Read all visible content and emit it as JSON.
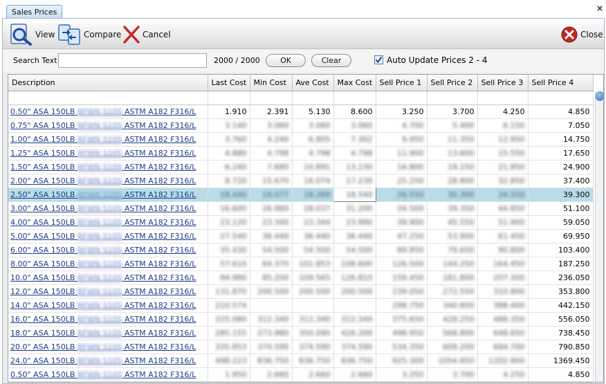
{
  "tab": {
    "label": "Sales Prices",
    "close": "×"
  },
  "toolbar": {
    "view": "View",
    "compare": "Compare",
    "cancel": "Cancel",
    "close": "Close"
  },
  "search": {
    "label": "Search Text",
    "value": "",
    "count": "2000 / 2000",
    "ok": "OK",
    "clear": "Clear",
    "auto_update_label": "Auto Update Prices 2 - 4",
    "auto_update_checked": true
  },
  "colors": {
    "accent": "#2d6cc1",
    "selected_row": "#b9dde8",
    "link": "#1c3a8c",
    "cancel_red": "#c62828"
  },
  "table": {
    "columns": [
      "Description",
      "Last Cost",
      "Min Cost",
      "Ave Cost",
      "Max Cost",
      "Sell Price 1",
      "Sell Price 2",
      "Sell Price 3",
      "Sell Price 4"
    ],
    "selected_index": 6,
    "rows": [
      {
        "size": "0.50\"",
        "spec": "ASTM A182 F316/L",
        "last": "1.910",
        "min": "2.391",
        "ave": "5.130",
        "max": "8.600",
        "p1": "3.250",
        "p2": "3.700",
        "p3": "4.250",
        "p4": "4.850",
        "clear": true
      },
      {
        "size": "0.75\"",
        "spec": "ASTM A182 F316/L",
        "last": "3.140",
        "min": "3.060",
        "ave": "3.060",
        "max": "3.060",
        "p1": "4.700",
        "p2": "5.400",
        "p3": "6.150",
        "p4": "7.050"
      },
      {
        "size": "1.00\"",
        "spec": "ASTM A182 F316/L",
        "last": "3.760",
        "min": "4.240",
        "ave": "6.805",
        "max": "7.302",
        "p1": "9.950",
        "p2": "11.350",
        "p3": "12.950",
        "p4": "14.750"
      },
      {
        "size": "1.25\"",
        "spec": "ASTM A182 F316/L",
        "last": "4.880",
        "min": "4.798",
        "ave": "4.798",
        "max": "4.798",
        "p1": "11.900",
        "p2": "13.600",
        "p3": "15.550",
        "p4": "17.650"
      },
      {
        "size": "1.50\"",
        "spec": "ASTM A182 F316/L",
        "last": "6.240",
        "min": "7.680",
        "ave": "10.891",
        "max": "13.230",
        "p1": "16.800",
        "p2": "19.150",
        "p3": "21.850",
        "p4": "24.900"
      },
      {
        "size": "2.00\"",
        "spec": "ASTM A182 F316/L",
        "last": "8.720",
        "min": "15.670",
        "ave": "16.074",
        "max": "17.230",
        "p1": "25.250",
        "p2": "28.800",
        "p3": "32.850",
        "p4": "37.400"
      },
      {
        "size": "2.50\"",
        "spec": "ASTM A182 F316/L",
        "last": "18.440",
        "min": "18.077",
        "ave": "18.269",
        "max": "18.540",
        "p1": "26.550",
        "p2": "30.300",
        "p3": "34.550",
        "p4": "39.300"
      },
      {
        "size": "3.00\"",
        "spec": "ASTM A182 F316/L",
        "last": "16.600",
        "min": "26.980",
        "ave": "28.037",
        "max": "31.200",
        "p1": "34.500",
        "p2": "39.350",
        "p3": "44.850",
        "p4": "51.100"
      },
      {
        "size": "4.00\"",
        "spec": "ASTM A182 F316/L",
        "last": "23.120",
        "min": "23.340",
        "ave": "23.344",
        "max": "23.990",
        "p1": "39.900",
        "p2": "45.550",
        "p3": "51.900",
        "p4": "59.050"
      },
      {
        "size": "5.00\"",
        "spec": "ASTM A182 F316/L",
        "last": "27.540",
        "min": "36.440",
        "ave": "36.440",
        "max": "36.440",
        "p1": "47.250",
        "p2": "53.900",
        "p3": "61.450",
        "p4": "69.950"
      },
      {
        "size": "6.00\"",
        "spec": "ASTM A182 F316/L",
        "last": "35.430",
        "min": "54.500",
        "ave": "54.500",
        "max": "54.500",
        "p1": "69.850",
        "p2": "79.650",
        "p3": "90.800",
        "p4": "103.400"
      },
      {
        "size": "8.00\"",
        "spec": "ASTM A182 F316/L",
        "last": "57.610",
        "min": "64.370",
        "ave": "101.853",
        "max": "108.600",
        "p1": "126.500",
        "p2": "144.250",
        "p3": "164.450",
        "p4": "187.250"
      },
      {
        "size": "10.0\"",
        "spec": "ASTM A182 F316/L",
        "last": "84.980",
        "min": "85.200",
        "ave": "109.565",
        "max": "126.810",
        "p1": "159.450",
        "p2": "181.800",
        "p3": "207.300",
        "p4": "236.050"
      },
      {
        "size": "12.0\"",
        "spec": "ASTM A182 F316/L",
        "last": "131.870",
        "min": "200.500",
        "ave": "200.500",
        "max": "200.500",
        "p1": "239.050",
        "p2": "272.550",
        "p3": "310.800",
        "p4": "353.800"
      },
      {
        "size": "14.0\"",
        "spec": "ASTM A182 F316/L",
        "last": "210.574",
        "min": "",
        "ave": "",
        "max": "",
        "p1": "298.750",
        "p2": "340.600",
        "p3": "388.400",
        "p4": "442.150"
      },
      {
        "size": "16.0\"",
        "spec": "ASTM A182 F316/L",
        "last": "225.080",
        "min": "312.340",
        "ave": "312.340",
        "max": "312.340",
        "p1": "375.650",
        "p2": "428.250",
        "p3": "488.350",
        "p4": "556.050"
      },
      {
        "size": "18.0\"",
        "spec": "ASTM A182 F316/L",
        "last": "285.155",
        "min": "273.980",
        "ave": "350.090",
        "max": "426.200",
        "p1": "498.950",
        "p2": "568.800",
        "p3": "648.650",
        "p4": "738.450"
      },
      {
        "size": "20.0\"",
        "spec": "ASTM A182 F316/L",
        "last": "335.853",
        "min": "374.590",
        "ave": "374.590",
        "max": "374.590",
        "p1": "534.350",
        "p2": "609.200",
        "p3": "694.700",
        "p4": "790.850"
      },
      {
        "size": "24.0\"",
        "spec": "ASTM A182 F316/L",
        "last": "498.223",
        "min": "836.750",
        "ave": "836.750",
        "max": "836.750",
        "p1": "925.300",
        "p2": "1054.850",
        "p3": "1202.900",
        "p4": "1369.450"
      },
      {
        "size": "0.50\"",
        "spec": "ASTM A182 F316/L",
        "last": "1.950",
        "min": "2.660",
        "ave": "2.660",
        "max": "2.660",
        "p1": "3.250",
        "p2": "3.700",
        "p3": "4.250",
        "p4": "4.850"
      }
    ],
    "desc_prefix": "ASA 150LB",
    "desc_blurred": "RFWN S10S"
  }
}
